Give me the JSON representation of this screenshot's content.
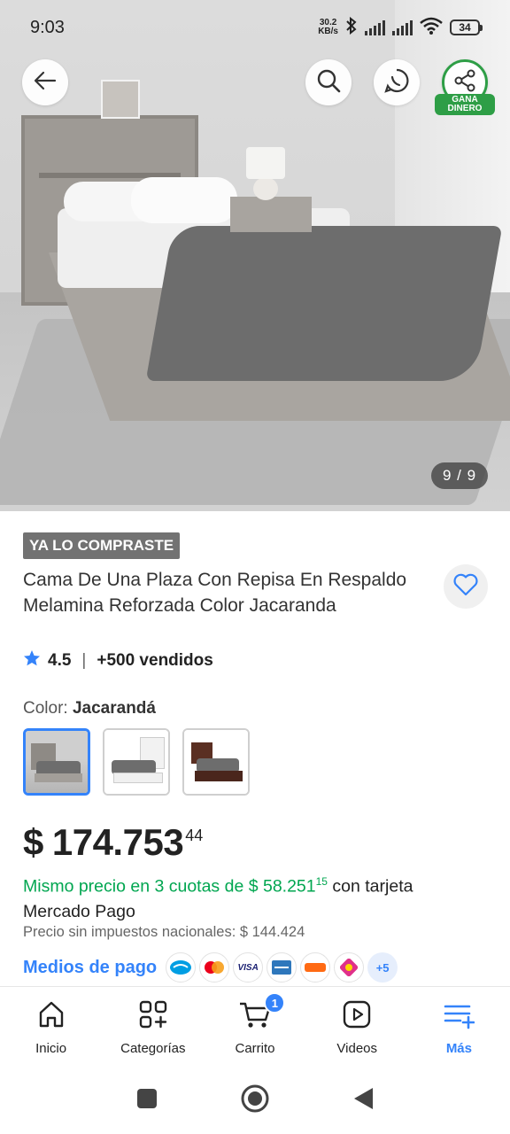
{
  "status_bar": {
    "time": "9:03",
    "net_speed_value": "30.2",
    "net_speed_unit": "KB/s",
    "battery": "34"
  },
  "hero": {
    "image_counter": "9 / 9",
    "share_badge_line1": "GANA",
    "share_badge_line2": "DINERO"
  },
  "product": {
    "badge": "YA LO COMPRASTE",
    "title": "Cama De Una Plaza Con Repisa En Respaldo Melamina Reforzada Color Jacaranda",
    "rating": "4.5",
    "separator": "|",
    "sold": "+500 vendidos",
    "color_label": "Color:",
    "color_value": "Jacarandá",
    "variants": [
      "Jacarandá",
      "Blanco",
      "Wengué"
    ]
  },
  "price": {
    "currency": "$",
    "amount": "174.753",
    "cents": "44",
    "cuotas_text": "Mismo precio en 3 cuotas de",
    "cuota_amount": "$ 58.251",
    "cuota_cents": "15",
    "cuotas_suffix": "con tarjeta Mercado Pago",
    "sin_impuestos": "Precio sin impuestos nacionales: $ 144.424",
    "medios_label": "Medios de pago",
    "more_methods": "+5",
    "payment_icons": [
      "mercado-pago-icon",
      "mastercard-icon",
      "visa-icon",
      "amex-icon",
      "naranja-icon",
      "cabal-icon"
    ]
  },
  "bottom_nav": {
    "items": [
      {
        "label": "Inicio",
        "icon": "home-icon"
      },
      {
        "label": "Categorías",
        "icon": "categories-icon"
      },
      {
        "label": "Carrito",
        "icon": "cart-icon"
      },
      {
        "label": "Videos",
        "icon": "videos-icon"
      },
      {
        "label": "Más",
        "icon": "menu-plus-icon"
      }
    ],
    "cart_count": "1"
  },
  "colors": {
    "accent": "#3483fa",
    "green": "#00a650",
    "share_green": "#2e9e46"
  }
}
